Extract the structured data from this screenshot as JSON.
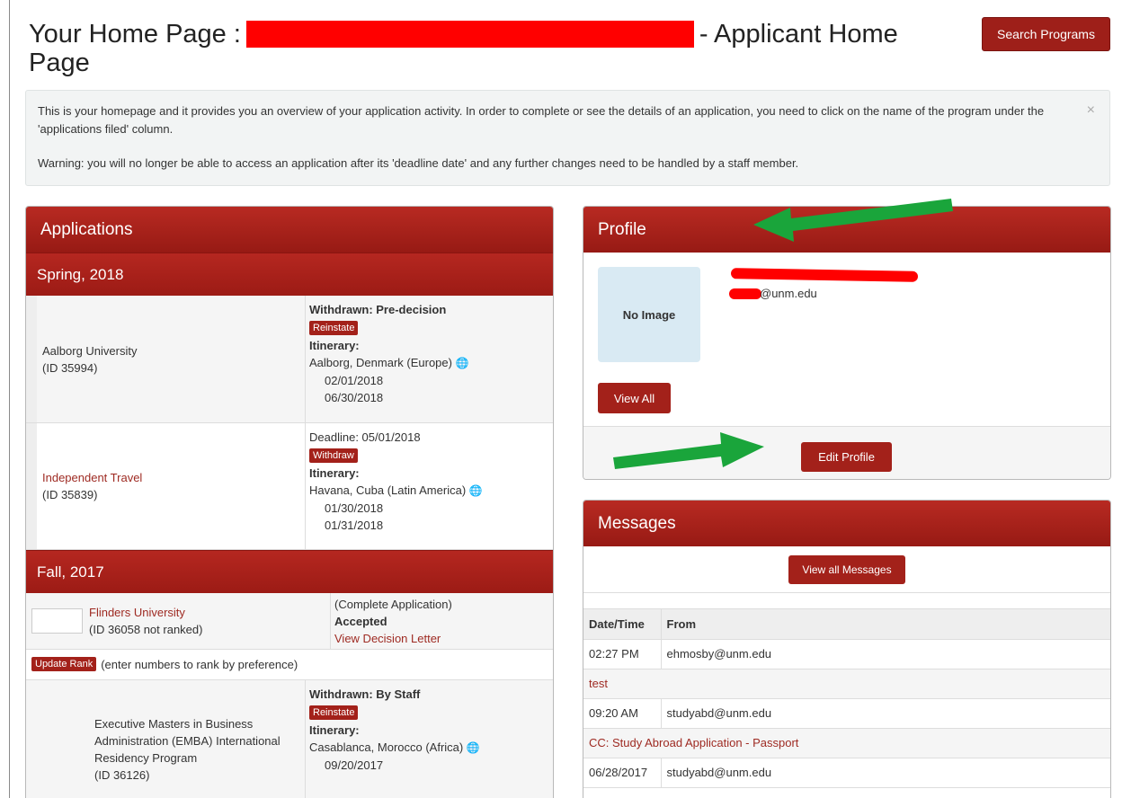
{
  "header": {
    "title_prefix": "Your Home Page :",
    "title_suffix": "- Applicant Home Page",
    "search_button": "Search Programs"
  },
  "alert": {
    "text1": "This is your homepage and it provides you an overview of your application activity. In order to complete or see the details of an application, you need to click on the name of the program under the 'applications filed' column.",
    "text2": "Warning: you will no longer be able to access an application after its 'deadline date' and any further changes need to be handled by a staff member.",
    "close": "×"
  },
  "applications": {
    "heading": "Applications",
    "terms": [
      {
        "name": "Spring, 2018",
        "rows": [
          {
            "program": "Aalborg University",
            "id": "(ID 35994)",
            "status": "Withdrawn: Pre-decision",
            "button": "Reinstate",
            "itinerary_label": "Itinerary:",
            "location": "Aalborg, Denmark (Europe)",
            "start": "02/01/2018",
            "end": "06/30/2018"
          },
          {
            "program": "Independent Travel",
            "id": "(ID 35839)",
            "status": "Deadline: 05/01/2018",
            "button": "Withdraw",
            "itinerary_label": "Itinerary:",
            "location": "Havana, Cuba (Latin America)",
            "start": "01/30/2018",
            "end": "01/31/2018"
          }
        ]
      },
      {
        "name": "Fall, 2017",
        "ranked": {
          "program": "Flinders University",
          "id": "(ID 36058 not ranked)",
          "note": "(Complete Application)",
          "status": "Accepted",
          "link": "View Decision Letter"
        },
        "update_rank_button": "Update Rank",
        "update_rank_note": "(enter numbers to rank by preference)",
        "rows": [
          {
            "program": "Executive Masters in Business Administration (EMBA) International Residency Program",
            "id": "(ID 36126)",
            "status": "Withdrawn: By Staff",
            "button": "Reinstate",
            "itinerary_label": "Itinerary:",
            "location": "Casablanca, Morocco (Africa)",
            "start": "09/20/2017"
          }
        ]
      }
    ]
  },
  "profile": {
    "heading": "Profile",
    "no_image": "No Image",
    "email": "@unm.edu",
    "view_all": "View All",
    "edit_profile": "Edit Profile"
  },
  "messages": {
    "heading": "Messages",
    "view_all": "View all Messages",
    "columns": [
      "Date/Time",
      "From"
    ],
    "items": [
      {
        "time": "02:27 PM",
        "from": "ehmosby@unm.edu",
        "subject": "test"
      },
      {
        "time": "09:20 AM",
        "from": "studyabd@unm.edu",
        "subject": "CC: Study Abroad Application - Passport"
      },
      {
        "time": "06/28/2017",
        "from": "studyabd@unm.edu",
        "subject": ""
      }
    ]
  },
  "colors": {
    "brand_red": "#9e1f19",
    "annotation_green": "#1aa53b",
    "redaction_red": "#ff0000"
  }
}
